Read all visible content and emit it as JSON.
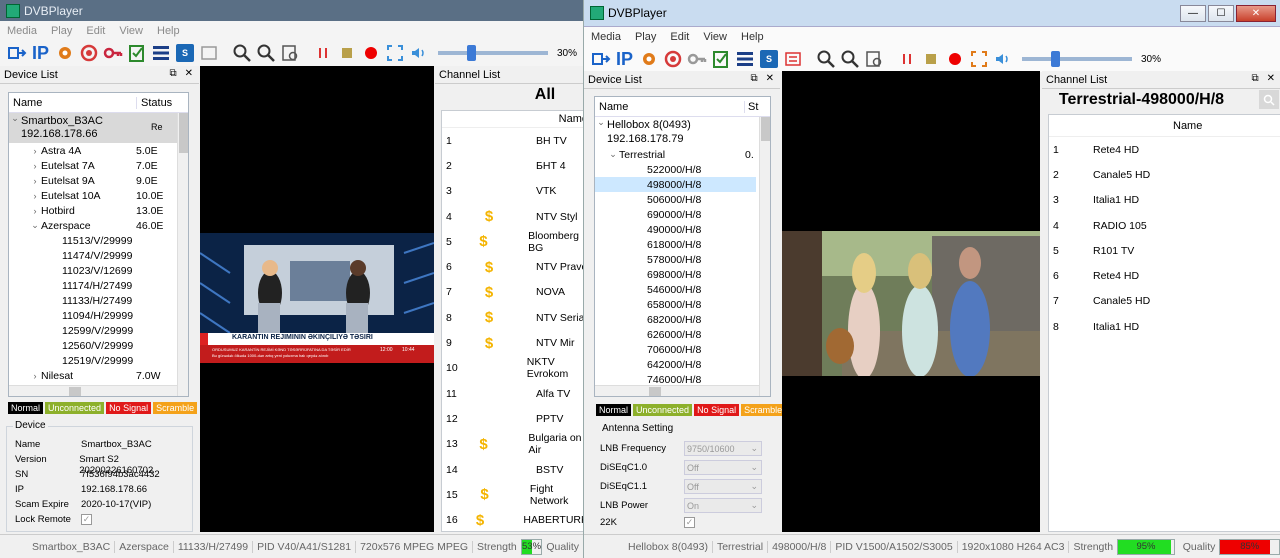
{
  "left": {
    "title": "DVBPlayer",
    "menu": [
      "Media",
      "Play",
      "Edit",
      "View",
      "Help"
    ],
    "toolbar": {
      "ip_label": "IP",
      "cam_label": "CAM",
      "volume_percent": 30,
      "volume_label": "30%"
    },
    "device_list": {
      "title": "Device List",
      "col_name": "Name",
      "col_status": "Status",
      "device": {
        "name": "Smartbox_B3AC",
        "ip": "192.168.178.66",
        "status": "Re"
      },
      "satellites": [
        {
          "name": "Astra 4A",
          "pos": "5.0E"
        },
        {
          "name": "Eutelsat 7A",
          "pos": "7.0E"
        },
        {
          "name": "Eutelsat 9A",
          "pos": "9.0E"
        },
        {
          "name": "Eutelsat 10A",
          "pos": "10.0E"
        },
        {
          "name": "Hotbird",
          "pos": "13.0E"
        },
        {
          "name": "Azerspace",
          "pos": "46.0E"
        }
      ],
      "transponders": [
        "11513/V/29999",
        "11474/V/29999",
        "11023/V/12699",
        "11174/H/27499",
        "11133/H/27499",
        "11094/H/29999",
        "12599/V/29999",
        "12560/V/29999",
        "12519/V/29999"
      ],
      "last_sat": {
        "name": "Nilesat",
        "pos": "7.0W"
      }
    },
    "legend": [
      "Normal",
      "Unconnected",
      "No Signal",
      "Scramble"
    ],
    "device_info": {
      "title": "Device",
      "rows": [
        {
          "k": "Name",
          "v": "Smartbox_B3AC"
        },
        {
          "k": "Version",
          "v": "Smart S2 20200226160702"
        },
        {
          "k": "SN",
          "v": "7f536f94b3ac4432"
        },
        {
          "k": "IP",
          "v": "192.168.178.66"
        },
        {
          "k": "Scam Expire",
          "v": "2020-10-17(VIP)"
        },
        {
          "k": "Lock Remote",
          "v": ""
        }
      ]
    },
    "video": {
      "ticker_headline": "KARANTİN REJİMİNİN ƏKİNÇİLİYƏ TƏSİRİ",
      "ticker_sub": "ORDUSUMUZ KARANTİN REJİMİ KƏND TƏSƏRRÜFATINA DA TƏSİR EDİR",
      "ticker_small": "Bu günədək ölkədə 1000-dən artıq yeni yoluxma halı qeydə alınıb",
      "ticker_time": "12:00",
      "ticker_time2": "10:44"
    },
    "channel_list": {
      "title": "Channel List",
      "heading": "All",
      "col_name": "Name",
      "channels": [
        {
          "n": "1",
          "name": "BH TV",
          "paid": false
        },
        {
          "n": "2",
          "name": "БНТ 4",
          "paid": false
        },
        {
          "n": "3",
          "name": "VTK",
          "paid": false
        },
        {
          "n": "4",
          "name": "NTV Styl",
          "paid": true
        },
        {
          "n": "5",
          "name": "Bloomberg BG",
          "paid": true
        },
        {
          "n": "6",
          "name": "NTV Pravo",
          "paid": true
        },
        {
          "n": "7",
          "name": "NOVA",
          "paid": true
        },
        {
          "n": "8",
          "name": "NTV Serial",
          "paid": true
        },
        {
          "n": "9",
          "name": "NTV Mir",
          "paid": true
        },
        {
          "n": "10",
          "name": "NKTV Evrokom",
          "paid": false
        },
        {
          "n": "11",
          "name": "Alfa TV",
          "paid": false
        },
        {
          "n": "12",
          "name": "PPTV",
          "paid": false
        },
        {
          "n": "13",
          "name": "Bulgaria on Air",
          "paid": true
        },
        {
          "n": "14",
          "name": "BSTV",
          "paid": false
        },
        {
          "n": "15",
          "name": "Fight Network",
          "paid": true
        },
        {
          "n": "16",
          "name": "HABERTURK",
          "paid": true
        }
      ]
    },
    "status": {
      "device": "Smartbox_B3AC",
      "sat": "Azerspace",
      "tp": "11133/H/27499",
      "pid": "PID V40/A41/S1281",
      "format": "720x576 MPEG MPEG",
      "strength_label": "Strength",
      "strength_value": 53,
      "strength_text": "53%",
      "quality_label": "Quality"
    }
  },
  "right": {
    "title": "DVBPlayer",
    "menu": [
      "Media",
      "Play",
      "Edit",
      "View",
      "Help"
    ],
    "window_buttons": {
      "min": "—",
      "max": "☐",
      "close": "✕"
    },
    "toolbar": {
      "ip_label": "IP",
      "cam_label": "CAM",
      "volume_percent": 30,
      "volume_label": "30%"
    },
    "device_list": {
      "title": "Device List",
      "col_name": "Name",
      "col_status": "St",
      "device": {
        "name": "Hellobox 8(0493)",
        "ip": "192.168.178.79"
      },
      "group": {
        "name": "Terrestrial",
        "status": "0."
      },
      "frequencies": [
        "522000/H/8",
        "498000/H/8",
        "506000/H/8",
        "690000/H/8",
        "490000/H/8",
        "618000/H/8",
        "578000/H/8",
        "698000/H/8",
        "546000/H/8",
        "658000/H/8",
        "682000/H/8",
        "626000/H/8",
        "706000/H/8",
        "642000/H/8",
        "746000/H/8"
      ],
      "selected_frequency": "498000/H/8"
    },
    "legend": [
      "Normal",
      "Unconnected",
      "No Signal",
      "Scramble"
    ],
    "antenna": {
      "title": "Antenna Setting",
      "rows": [
        {
          "k": "LNB Frequency",
          "v": "9750/10600"
        },
        {
          "k": "DiSEqC1.0",
          "v": "Off"
        },
        {
          "k": "DiSEqC1.1",
          "v": "Off"
        },
        {
          "k": "LNB Power",
          "v": "On"
        },
        {
          "k": "22K",
          "v": ""
        }
      ]
    },
    "channel_list": {
      "title": "Channel List",
      "heading": "Terrestrial-498000/H/8",
      "col_name": "Name",
      "channels": [
        {
          "n": "1",
          "name": "Rete4 HD"
        },
        {
          "n": "2",
          "name": "Canale5 HD"
        },
        {
          "n": "3",
          "name": "Italia1 HD"
        },
        {
          "n": "4",
          "name": "RADIO 105"
        },
        {
          "n": "5",
          "name": "R101 TV"
        },
        {
          "n": "6",
          "name": "Rete4 HD"
        },
        {
          "n": "7",
          "name": "Canale5 HD"
        },
        {
          "n": "8",
          "name": "Italia1 HD"
        }
      ]
    },
    "status": {
      "device": "Hellobox 8(0493)",
      "sat": "Terrestrial",
      "tp": "498000/H/8",
      "pid": "PID V1500/A1502/S3005",
      "format": "1920x1080 H264 AC3",
      "strength_label": "Strength",
      "strength_value": 95,
      "strength_text": "95%",
      "quality_label": "Quality",
      "quality_value": 85,
      "quality_text": "85%"
    }
  },
  "colors": {
    "legend_normal": "#000000",
    "legend_unconnected": "#8db02b",
    "legend_nosignal": "#e01919",
    "legend_scramble": "#f4a21a",
    "strength_green": "#22dd22",
    "quality_red": "#ee0000",
    "selection": "#cde8ff"
  }
}
